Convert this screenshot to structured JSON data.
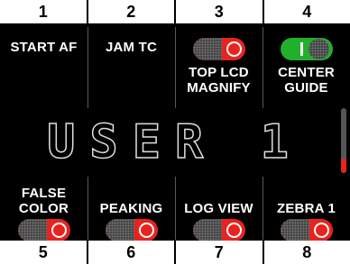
{
  "top_tabs": [
    "1",
    "2",
    "3",
    "4"
  ],
  "bottom_tabs": [
    "5",
    "6",
    "7",
    "8"
  ],
  "top_buttons": [
    {
      "label": "START AF",
      "toggle": null
    },
    {
      "label": "JAM TC",
      "toggle": null
    },
    {
      "label_line1": "TOP LCD",
      "label_line2": "MAGNIFY",
      "toggle": "off"
    },
    {
      "label_line1": "CENTER",
      "label_line2": "GUIDE",
      "toggle": "on"
    }
  ],
  "bottom_buttons": [
    {
      "label_line1": "FALSE",
      "label_line2": "COLOR",
      "toggle": "off"
    },
    {
      "label": "PEAKING",
      "toggle": "off"
    },
    {
      "label": "LOG VIEW",
      "toggle": "off"
    },
    {
      "label": "ZEBRA 1",
      "toggle": "off"
    }
  ],
  "user_title": "USER 1",
  "scroll_position": 0.85,
  "colors": {
    "toggle_off": "#e8231f",
    "toggle_on": "#22b02c",
    "tab_bg": "#ffffff"
  }
}
